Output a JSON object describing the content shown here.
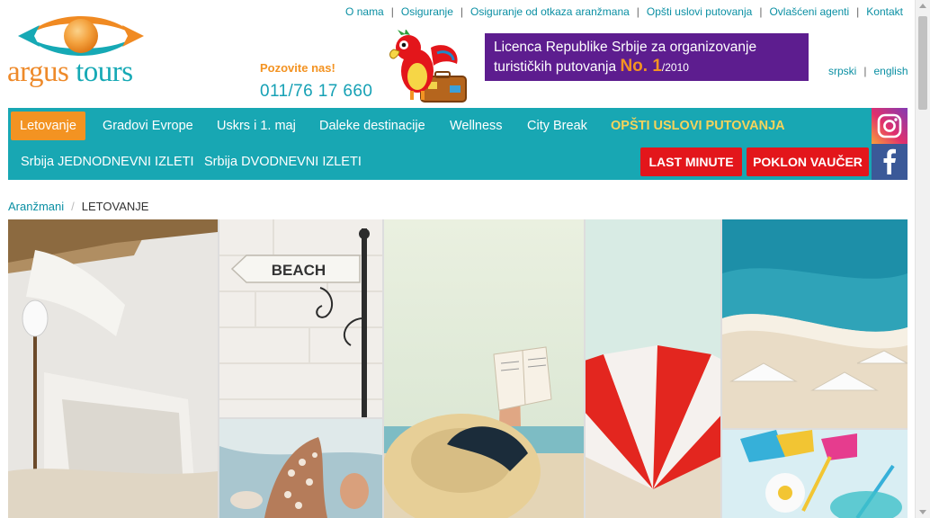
{
  "top_links": [
    {
      "label": "O nama"
    },
    {
      "label": "Osiguranje"
    },
    {
      "label": "Osiguranje od otkaza aranžmana"
    },
    {
      "label": "Opšti uslovi putovanja"
    },
    {
      "label": "Ovlašćeni agenti"
    },
    {
      "label": "Kontakt"
    }
  ],
  "logo": {
    "word1": "argus",
    "word2": "tours",
    "icon": "eye-sun-logo-icon"
  },
  "contact": {
    "call_label": "Pozovite nas!",
    "phone": "011/76 17 660"
  },
  "mascot": {
    "icon": "parrot-mascot-icon"
  },
  "license": {
    "text": "Licenca Republike Srbije za organizovanje turističkih putovanja",
    "highlight": "No. 1",
    "year": "/2010"
  },
  "languages": [
    {
      "label": "srpski"
    },
    {
      "label": "english"
    }
  ],
  "nav": {
    "row1": [
      {
        "label": "Letovanje"
      },
      {
        "label": "Gradovi Evrope"
      },
      {
        "label": "Uskrs i 1. maj"
      },
      {
        "label": "Daleke destinacije"
      },
      {
        "label": "Wellness"
      },
      {
        "label": "City Break"
      },
      {
        "label": "OPŠTI USLOVI PUTOVANJA"
      }
    ],
    "row2": [
      {
        "label": "Srbija JEDNODNEVNI IZLETI"
      },
      {
        "label": "Srbija DVODNEVNI IZLETI"
      }
    ],
    "buttons": {
      "last_minute": "LAST MINUTE",
      "voucher": "POKLON VAUČER"
    },
    "social": [
      {
        "icon": "instagram-icon"
      },
      {
        "icon": "facebook-icon"
      }
    ]
  },
  "breadcrumb": {
    "parent": "Aranžmani",
    "current": "LETOVANJE"
  },
  "banner": {
    "sign_text": "BEACH"
  },
  "colors": {
    "teal": "#18a7b3",
    "orange": "#f39322",
    "purple": "#5d1d8f",
    "red": "#e3161b",
    "link": "#0a8fa3"
  }
}
